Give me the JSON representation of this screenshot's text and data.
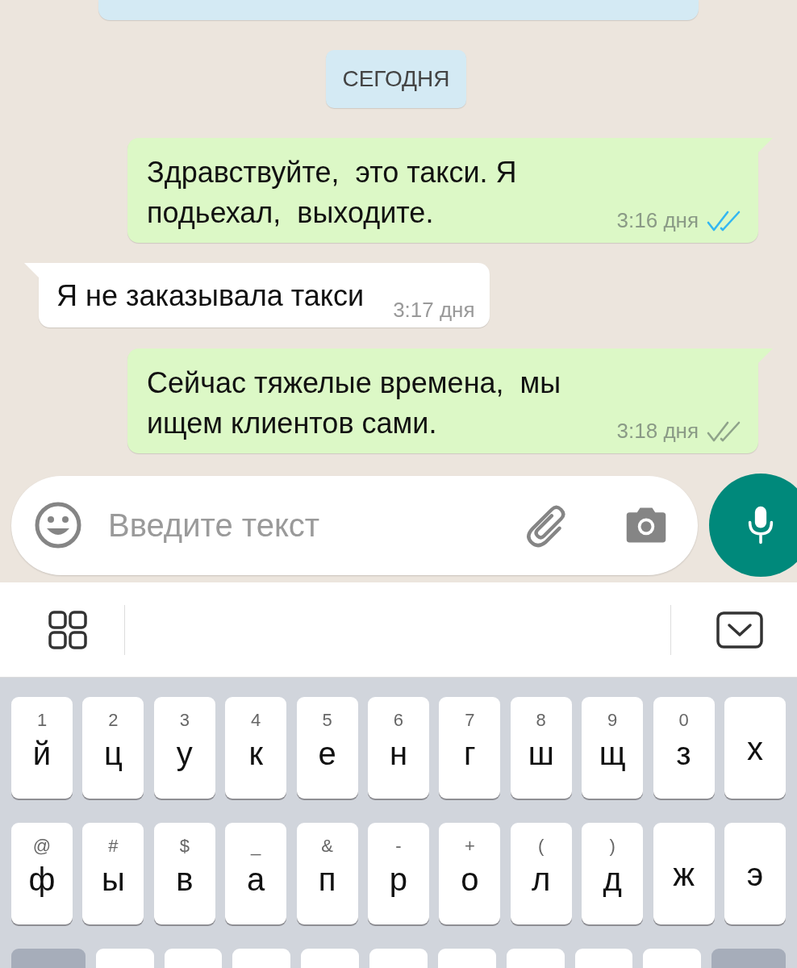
{
  "date_chip": "СЕГОДНЯ",
  "messages": [
    {
      "kind": "outgoing",
      "text": "Здравствуйте,  это такси. Я подьехал,  выходите.",
      "time": "3:16 дня",
      "read": true
    },
    {
      "kind": "incoming",
      "text": "Я не заказывала такси",
      "time": "3:17 дня"
    },
    {
      "kind": "outgoing",
      "text": "Сейчас тяжелые времена,  мы ищем клиентов сами.",
      "time": "3:18 дня",
      "read": false
    }
  ],
  "composer": {
    "placeholder": "Введите текст"
  },
  "keyboard": {
    "rows": [
      [
        {
          "hint": "1",
          "letter": "й"
        },
        {
          "hint": "2",
          "letter": "ц"
        },
        {
          "hint": "3",
          "letter": "у"
        },
        {
          "hint": "4",
          "letter": "к"
        },
        {
          "hint": "5",
          "letter": "е"
        },
        {
          "hint": "6",
          "letter": "н"
        },
        {
          "hint": "7",
          "letter": "г"
        },
        {
          "hint": "8",
          "letter": "ш"
        },
        {
          "hint": "9",
          "letter": "щ"
        },
        {
          "hint": "0",
          "letter": "з"
        },
        {
          "letter": "х"
        }
      ],
      [
        {
          "hint": "@",
          "letter": "ф"
        },
        {
          "hint": "#",
          "letter": "ы"
        },
        {
          "hint": "$",
          "letter": "в"
        },
        {
          "hint": "_",
          "letter": "а"
        },
        {
          "hint": "&",
          "letter": "п"
        },
        {
          "hint": "-",
          "letter": "р"
        },
        {
          "hint": "+",
          "letter": "о"
        },
        {
          "hint": "(",
          "letter": "л"
        },
        {
          "hint": ")",
          "letter": "д"
        },
        {
          "letter": "ж"
        },
        {
          "letter": "э"
        }
      ]
    ],
    "bottom_row": [
      {
        "kind": "function"
      },
      {
        "kind": "letter"
      },
      {
        "kind": "letter"
      },
      {
        "kind": "letter"
      },
      {
        "kind": "letter"
      },
      {
        "kind": "letter"
      },
      {
        "kind": "letter"
      },
      {
        "kind": "letter"
      },
      {
        "kind": "letter"
      },
      {
        "kind": "letter"
      },
      {
        "kind": "function"
      }
    ]
  }
}
